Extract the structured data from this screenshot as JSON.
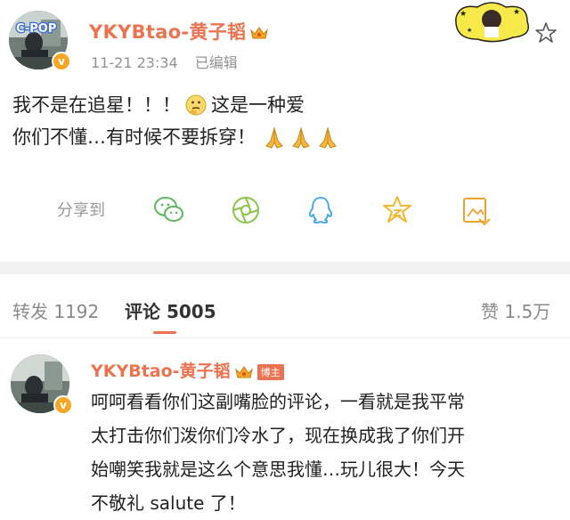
{
  "post": {
    "username": "YKYBtao-黄子韬",
    "timestamp": "11-21 23:34",
    "edited": "已编辑",
    "avatar_tag": "C-POP",
    "body_lines": [
      [
        "我不是在追星！！！",
        "这是一种爱"
      ],
      [
        "你们不懂…有时候不要拆穿！"
      ]
    ],
    "verified_badge": "v"
  },
  "share": {
    "label": "分享到",
    "icons": [
      "wechat-icon",
      "moments-icon",
      "qq-icon",
      "qzone-icon",
      "save-image-icon"
    ]
  },
  "tabs": {
    "repost": "转发 1192",
    "comments": "评论 5005",
    "likes": "赞 1.5万"
  },
  "comment": {
    "username": "YKYBtao-黄子韬",
    "host_badge": "博主",
    "lines": [
      "呵呵看看你们这副嘴脸的评论，一看就是我平常",
      "太打击你们泼你们冷水了，现在换成我了你们开",
      "始嘲笑我就是这么个意思我懂…玩儿很大！今天",
      "不敬礼 salute 了！"
    ]
  },
  "colors": {
    "accent": "#eb7350",
    "gold": "#f5a623",
    "muted": "#939393",
    "divider": "#f2f2f2"
  }
}
